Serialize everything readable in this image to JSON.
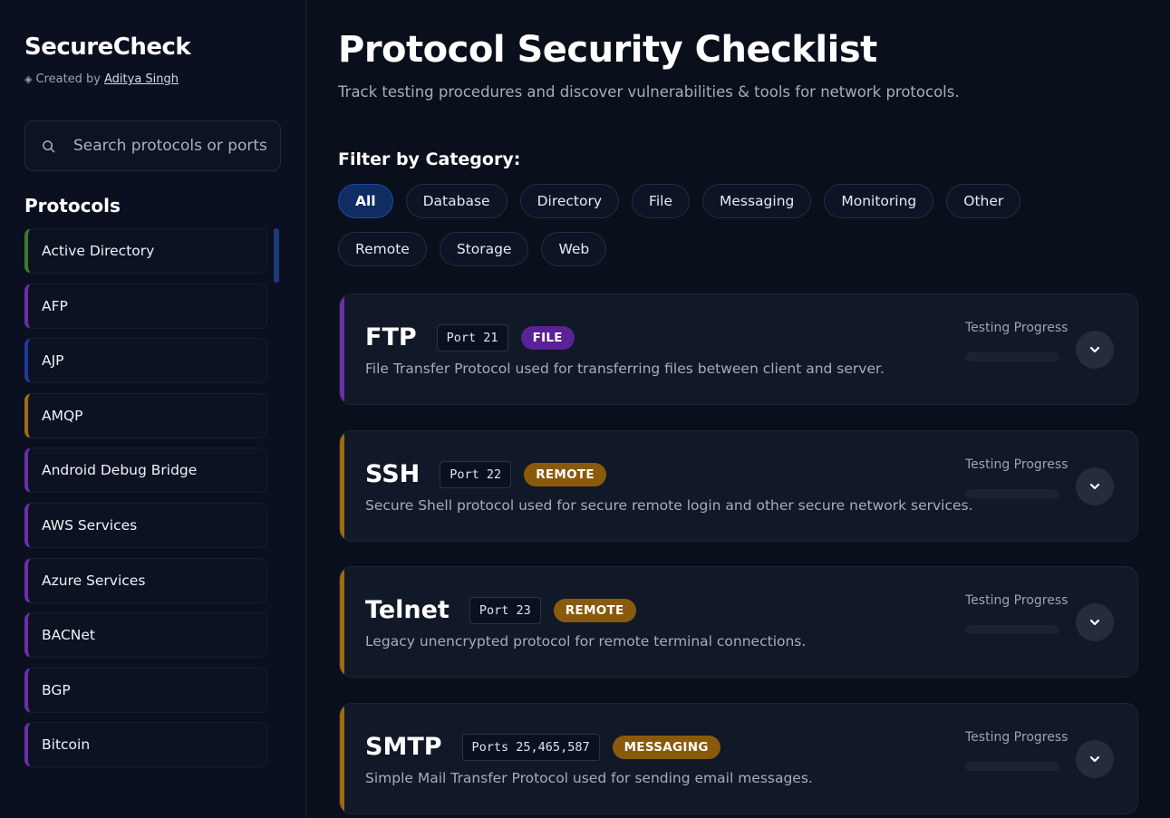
{
  "sidebar": {
    "brand": "SecureCheck",
    "credit_prefix": "Created by",
    "credit_author": "Aditya Singh",
    "search_placeholder": "Search protocols or ports",
    "protocols_heading": "Protocols",
    "items": [
      {
        "label": "Active Directory",
        "color": "#3f7a2a"
      },
      {
        "label": "AFP",
        "color": "#6b2fa8"
      },
      {
        "label": "AJP",
        "color": "#1f3a9e"
      },
      {
        "label": "AMQP",
        "color": "#a06a10"
      },
      {
        "label": "Android Debug Bridge",
        "color": "#6b2fa8"
      },
      {
        "label": "AWS Services",
        "color": "#6b2fa8"
      },
      {
        "label": "Azure Services",
        "color": "#6b2fa8"
      },
      {
        "label": "BACNet",
        "color": "#6b2fa8"
      },
      {
        "label": "BGP",
        "color": "#6b2fa8"
      },
      {
        "label": "Bitcoin",
        "color": "#6b2fa8"
      }
    ]
  },
  "main": {
    "title": "Protocol Security Checklist",
    "subtitle": "Track testing procedures and discover vulnerabilities & tools for network protocols.",
    "filter_label": "Filter by Category:",
    "filters": [
      "All",
      "Database",
      "Directory",
      "File",
      "Messaging",
      "Monitoring",
      "Other",
      "Remote",
      "Storage",
      "Web"
    ],
    "active_filter": "All",
    "progress_label": "Testing Progress",
    "cards": [
      {
        "name": "FTP",
        "port": "Port 21",
        "badge": "FILE",
        "badge_color": "#5b2196",
        "accent": "#6b2fa8",
        "progress": 0,
        "desc": "File Transfer Protocol used for transferring files between client and server."
      },
      {
        "name": "SSH",
        "port": "Port 22",
        "badge": "REMOTE",
        "badge_color": "#8a5a0c",
        "accent": "#a06a10",
        "progress": 0,
        "desc": "Secure Shell protocol used for secure remote login and other secure network services."
      },
      {
        "name": "Telnet",
        "port": "Port 23",
        "badge": "REMOTE",
        "badge_color": "#8a5a0c",
        "accent": "#a06a10",
        "progress": 0,
        "desc": "Legacy unencrypted protocol for remote terminal connections."
      },
      {
        "name": "SMTP",
        "port": "Ports 25,465,587",
        "badge": "MESSAGING",
        "badge_color": "#8a5a0c",
        "accent": "#a06a10",
        "progress": 0,
        "desc": "Simple Mail Transfer Protocol used for sending email messages."
      }
    ]
  },
  "icons": {
    "search": "search-icon",
    "expand": "chevron-down-icon",
    "credit": "diamond-icon"
  }
}
